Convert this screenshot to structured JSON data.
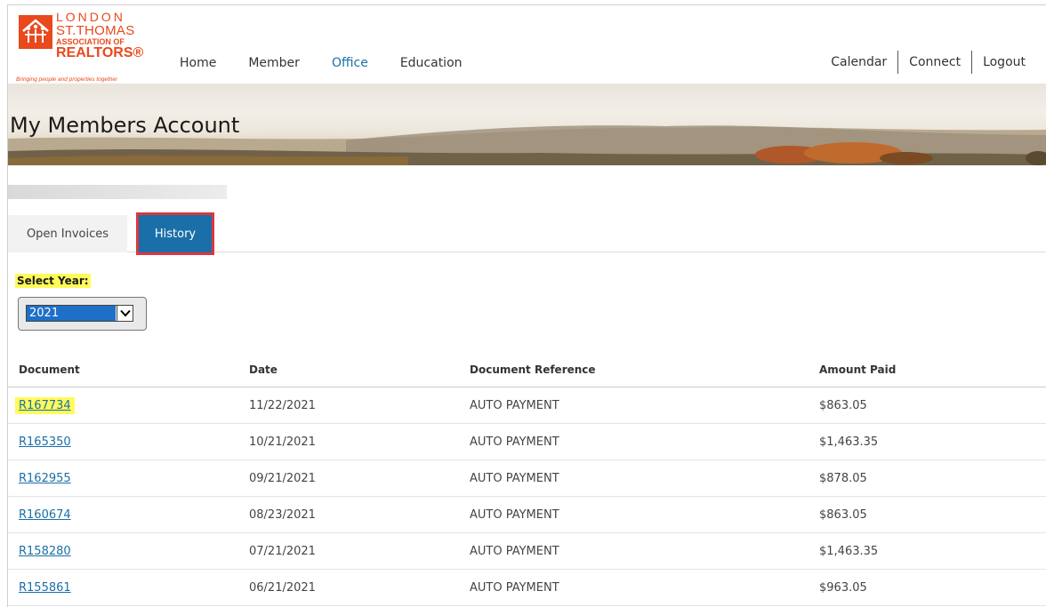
{
  "logo": {
    "line1": "LONDON",
    "line2": "ST.THOMAS",
    "line3": "ASSOCIATION OF",
    "line4": "REALTORS®",
    "tagline": "Bringing people and properties together",
    "brand_color": "#e8491d"
  },
  "nav": {
    "items": [
      "Home",
      "Member",
      "Office",
      "Education"
    ],
    "active": "Office",
    "right": [
      "Calendar",
      "Connect",
      "Logout"
    ]
  },
  "banner": {
    "title": "My Members Account"
  },
  "tabs": {
    "open_invoices": "Open Invoices",
    "history": "History",
    "active": "History"
  },
  "year_select": {
    "label": "Select Year:",
    "value": "2021"
  },
  "table": {
    "headers": [
      "Document",
      "Date",
      "Document Reference",
      "Amount Paid"
    ],
    "rows": [
      {
        "document": "R167734",
        "date": "11/22/2021",
        "reference": "AUTO PAYMENT",
        "amount": "$863.05"
      },
      {
        "document": "R165350",
        "date": "10/21/2021",
        "reference": "AUTO PAYMENT",
        "amount": "$1,463.35"
      },
      {
        "document": "R162955",
        "date": "09/21/2021",
        "reference": "AUTO PAYMENT",
        "amount": "$878.05"
      },
      {
        "document": "R160674",
        "date": "08/23/2021",
        "reference": "AUTO PAYMENT",
        "amount": "$863.05"
      },
      {
        "document": "R158280",
        "date": "07/21/2021",
        "reference": "AUTO PAYMENT",
        "amount": "$1,463.35"
      },
      {
        "document": "R155861",
        "date": "06/21/2021",
        "reference": "AUTO PAYMENT",
        "amount": "$963.05"
      }
    ]
  },
  "colors": {
    "accent": "#1a6fa8",
    "highlight": "#fffb5a",
    "tab_outline": "#d9383f"
  }
}
